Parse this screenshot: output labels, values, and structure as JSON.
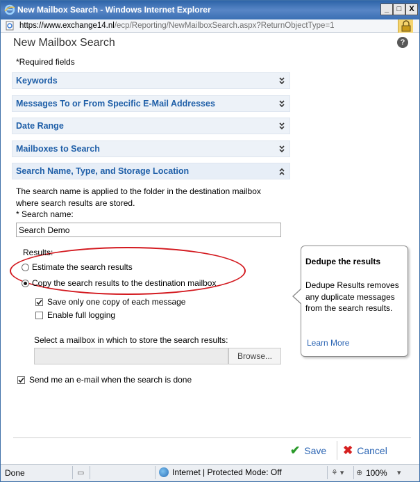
{
  "window": {
    "title": "New Mailbox Search - Windows Internet Explorer",
    "min_label": "_",
    "max_label": "□",
    "close_label": "X"
  },
  "address": {
    "scheme": "https://",
    "domain": "www.exchange14.nl",
    "path": "/ecp/Reporting/NewMailboxSearch.aspx?ReturnObjectType=1"
  },
  "dialog": {
    "title": "New Mailbox Search",
    "help_label": "?",
    "required_note": "*Required fields"
  },
  "sections": [
    {
      "label": "Keywords",
      "state": "collapsed"
    },
    {
      "label": "Messages To or From Specific E-Mail Addresses",
      "state": "collapsed"
    },
    {
      "label": "Date Range",
      "state": "collapsed"
    },
    {
      "label": "Mailboxes to Search",
      "state": "collapsed"
    },
    {
      "label": "Search Name, Type, and Storage Location",
      "state": "expanded"
    }
  ],
  "storage": {
    "description": "The search name is applied to the folder in the destination mailbox where search results are stored.",
    "search_name_label": "* Search name:",
    "search_name_value": "Search Demo",
    "results_label": "Results:",
    "options": [
      {
        "label": "Estimate the search results",
        "checked": false
      },
      {
        "label": "Copy the search results to the destination mailbox",
        "checked": true
      }
    ],
    "dedupe_label": "Save only one copy of each message",
    "dedupe_checked": true,
    "logging_label": "Enable full logging",
    "logging_checked": false,
    "mailbox_label": "Select a mailbox in which to store the search results:",
    "mailbox_value": "",
    "browse_label": "Browse...",
    "notify_label": "Send me an e-mail when the search is done",
    "notify_checked": true
  },
  "callout": {
    "title": "Dedupe the results",
    "body": "Dedupe Results removes any duplicate messages from the search results.",
    "link": "Learn More"
  },
  "footer": {
    "save_label": "Save",
    "cancel_label": "Cancel"
  },
  "statusbar": {
    "status": "Done",
    "zone": "Internet | Protected Mode: Off",
    "zoom": "100%"
  },
  "colors": {
    "section_label": "#1f5fa8",
    "highlight_ellipse": "#d3191f",
    "link": "#2a64b3",
    "save_icon": "#2a9a2a",
    "cancel_icon": "#d62020"
  }
}
